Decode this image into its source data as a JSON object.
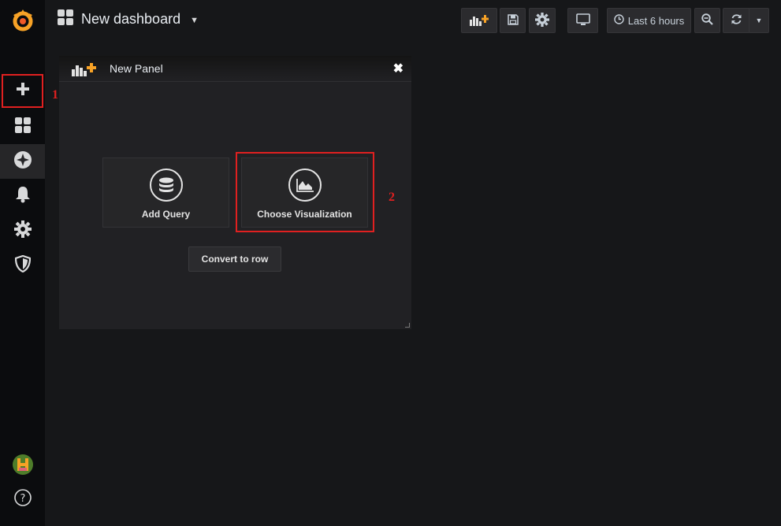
{
  "dashboard": {
    "title": "New dashboard"
  },
  "toolbar": {
    "time_range_label": "Last 6 hours"
  },
  "panel": {
    "title": "New Panel",
    "add_query_label": "Add Query",
    "choose_visualization_label": "Choose Visualization",
    "convert_to_row_label": "Convert to row"
  },
  "annotations": {
    "first": "1",
    "second": "2"
  },
  "colors": {
    "brand_orange": "#f7a226",
    "highlight_red": "#e02020",
    "background": "#161719"
  },
  "icons": {
    "sidebar": [
      "grafana-logo-icon",
      "plus-icon",
      "dashboards-icon",
      "explore-icon",
      "bell-icon",
      "gear-icon",
      "shield-icon",
      "avatar",
      "help-icon"
    ],
    "toolbar": [
      "add-panel-icon",
      "save-icon",
      "gear-icon",
      "monitor-icon",
      "clock-icon",
      "zoom-out-icon",
      "refresh-icon",
      "caret-down-icon"
    ]
  }
}
